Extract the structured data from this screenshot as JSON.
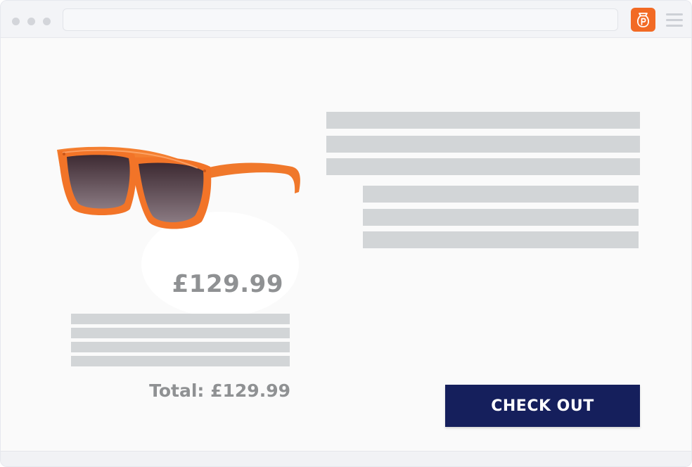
{
  "toolbar": {
    "window_controls": [
      "dot",
      "dot",
      "dot"
    ],
    "extension_icon": "p-bag-icon",
    "menu_icon": "hamburger-menu-icon",
    "accent_color": "#f26a24"
  },
  "product": {
    "image": "orange-sunglasses",
    "price": "£129.99"
  },
  "cart": {
    "total": "Total: £129.99"
  },
  "actions": {
    "checkout_label": "CHECK OUT",
    "checkout_color": "#151f5c"
  }
}
